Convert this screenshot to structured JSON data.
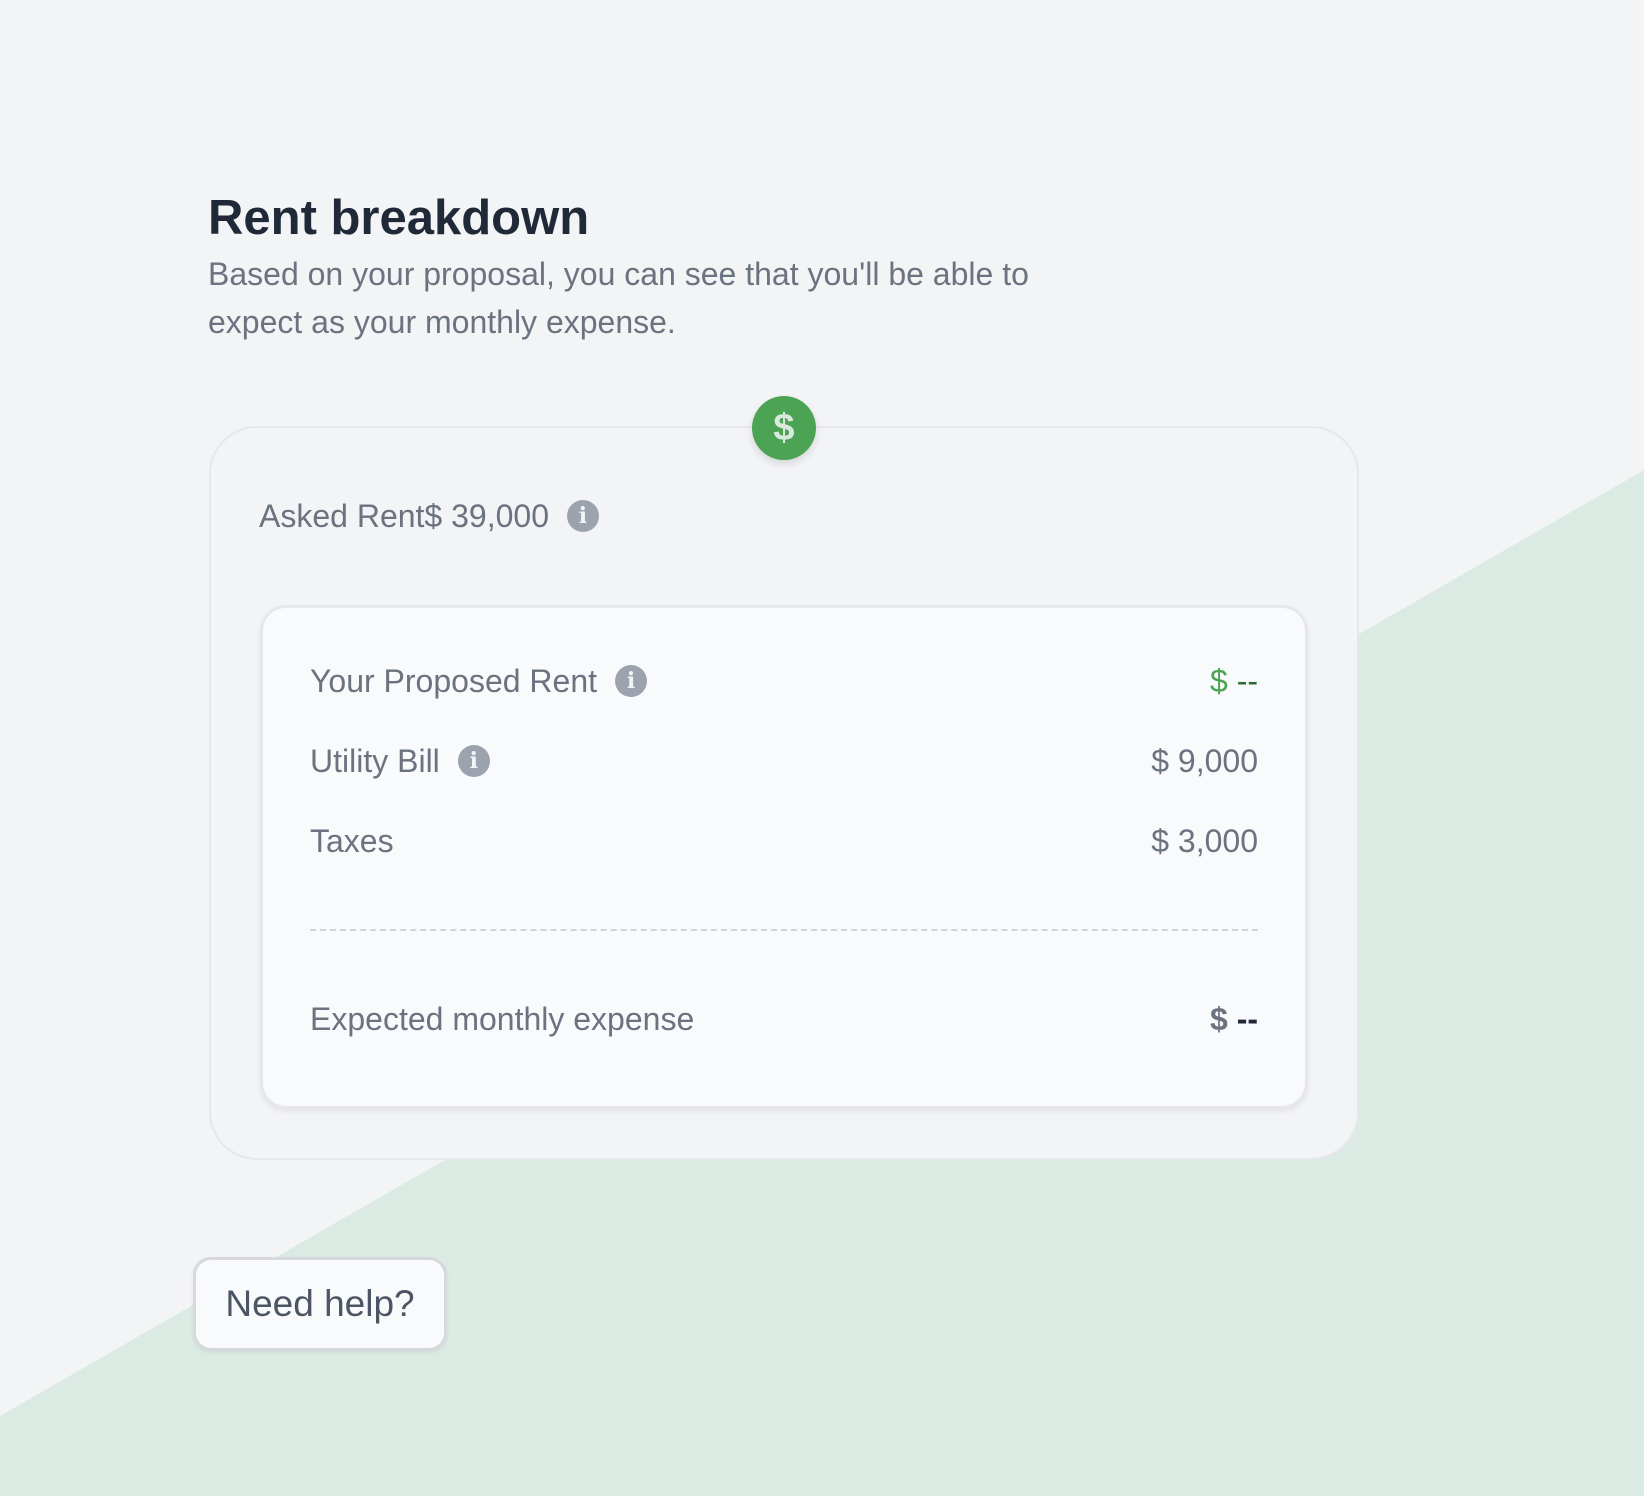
{
  "header": {
    "title": "Rent breakdown",
    "subtitle": "Based on your proposal, you can see that you'll be able to expect as your monthly expense."
  },
  "badge": {
    "symbol": "$",
    "icon": "dollar-icon",
    "color": "#4ba353"
  },
  "asked_rent": {
    "label": "Asked Rent",
    "value": "$ 39,000",
    "info_icon": "i"
  },
  "breakdown": {
    "proposed_rent": {
      "label": "Your Proposed Rent",
      "currency": "$",
      "value": "--",
      "info_icon": "i"
    },
    "utility_bill": {
      "label": "Utility Bill",
      "value": "$ 9,000",
      "info_icon": "i"
    },
    "taxes": {
      "label": "Taxes",
      "value": "$ 3,000"
    },
    "total": {
      "label": "Expected monthly expense",
      "currency": "$",
      "value": "--"
    }
  },
  "help": {
    "label": "Need help?"
  },
  "colors": {
    "background": "#f3f4f6",
    "accent_shape": "#dbebe3",
    "accent_green": "#4ba353",
    "title": "#1f2937",
    "muted_text": "#6b7280"
  }
}
